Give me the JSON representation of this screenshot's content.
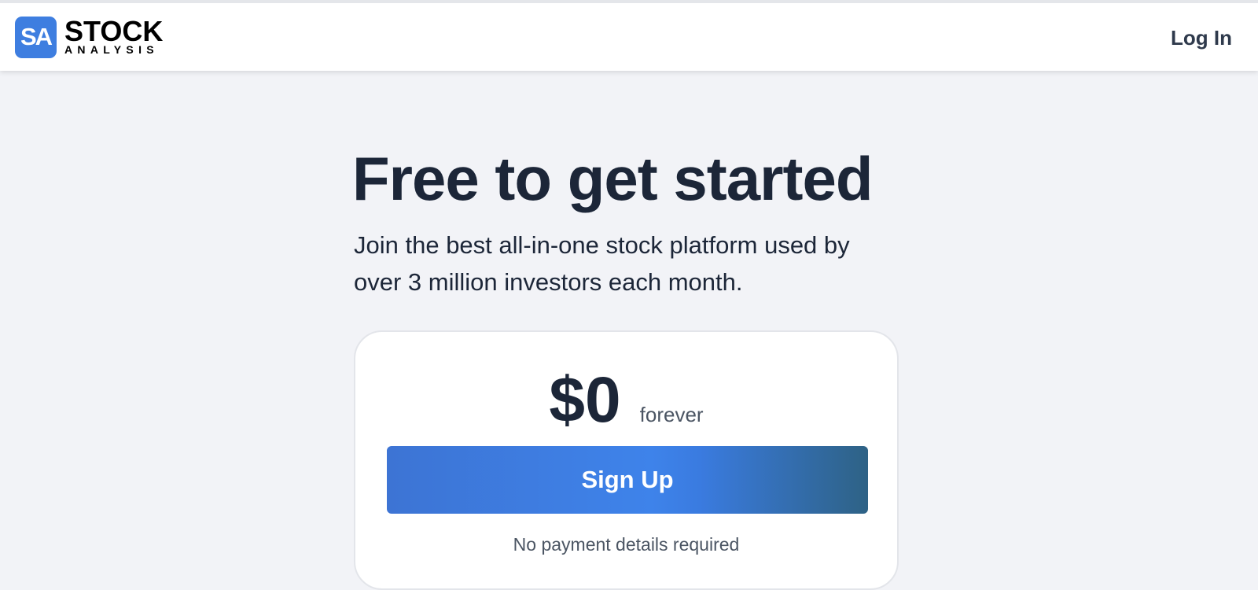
{
  "header": {
    "logo_badge": "SA",
    "logo_main": "STOCK",
    "logo_sub": "ANALYSIS",
    "login_label": "Log In"
  },
  "hero": {
    "title": "Free to get started",
    "subtitle_line1": "Join the best all-in-one stock platform used by",
    "subtitle_line2": "over 3 million investors each month."
  },
  "pricing": {
    "price": "$0",
    "period": "forever",
    "signup_label": "Sign Up",
    "note": "No payment details required"
  },
  "colors": {
    "brand_blue": "#3e7ee0",
    "page_background": "#f2f3f7",
    "heading_text": "#1c2638"
  }
}
